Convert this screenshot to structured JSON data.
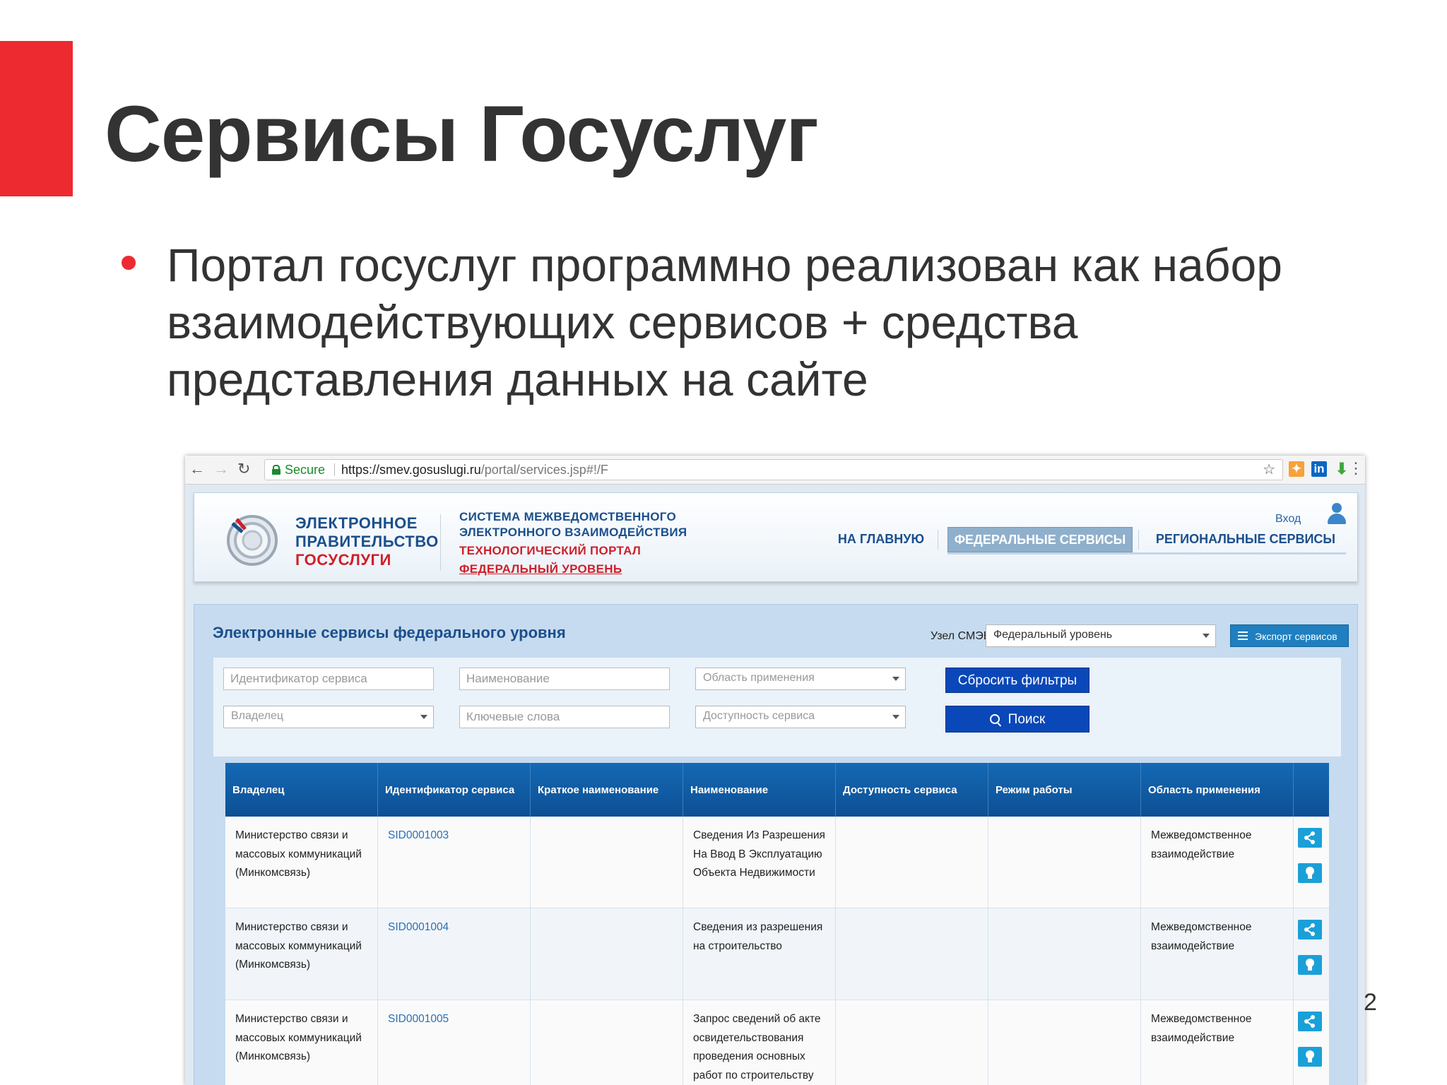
{
  "slide": {
    "title": "Сервисы Госуслуг",
    "bullet": "Портал госуслуг программно реализован как набор взаимодействующих сервисов + средства представления данных на сайте",
    "page_number": "2"
  },
  "browser": {
    "secure_label": "Secure",
    "url_host": "https://smev.gosuslugi.ru",
    "url_path": "/portal/services.jsp#!/F"
  },
  "header": {
    "brand": [
      "ЭЛЕКТРОННОЕ",
      "ПРАВИТЕЛЬСТВО",
      "ГОСУСЛУГИ"
    ],
    "system": [
      "СИСТЕМА МЕЖВЕДОМСТВЕННОГО",
      "ЭЛЕКТРОННОГО ВЗАИМОДЕЙСТВИЯ",
      "ТЕХНОЛОГИЧЕСКИЙ ПОРТАЛ",
      "ФЕДЕРАЛЬНЫЙ УРОВЕНЬ"
    ],
    "login": "Вход",
    "nav": [
      "НА ГЛАВНУЮ",
      "ФЕДЕРАЛЬНЫЕ СЕРВИСЫ",
      "РЕГИОНАЛЬНЫЕ СЕРВИСЫ"
    ]
  },
  "main": {
    "title": "Электронные сервисы федерального уровня",
    "node_label": "Узел СМЭВ:",
    "node_value": "Федеральный уровень",
    "export_label": "Экспорт сервисов"
  },
  "filters": {
    "id_placeholder": "Идентификатор сервиса",
    "name_placeholder": "Наименование",
    "area_placeholder": "Область применения",
    "owner_placeholder": "Владелец",
    "keywords_placeholder": "Ключевые слова",
    "availability_placeholder": "Доступность сервиса",
    "reset_label": "Сбросить фильтры",
    "search_label": "Поиск"
  },
  "table": {
    "columns": [
      "Владелец",
      "Идентификатор сервиса",
      "Краткое наименование",
      "Наименование",
      "Доступность сервиса",
      "Режим работы",
      "Область применения"
    ],
    "rows": [
      {
        "owner": "Министерство связи и массовых коммуникаций (Минкомсвязь)",
        "id": "SID0001003",
        "short": "",
        "name": "Сведения Из Разрешения На Ввод В Эксплуатацию Объекта Недвижимости",
        "availability": "",
        "mode": "",
        "area": "Межведомственное взаимодействие"
      },
      {
        "owner": "Министерство связи и массовых коммуникаций (Минкомсвязь)",
        "id": "SID0001004",
        "short": "",
        "name": "Сведения из разрешения на строительство",
        "availability": "",
        "mode": "",
        "area": "Межведомственное взаимодействие"
      },
      {
        "owner": "Министерство связи и массовых коммуникаций (Минкомсвязь)",
        "id": "SID0001005",
        "short": "",
        "name": "Запрос сведений об акте освидетельствования проведения основных работ по строительству",
        "availability": "",
        "mode": "",
        "area": "Межведомственное взаимодействие"
      }
    ]
  },
  "colors": {
    "accent_red": "#ee2a31",
    "title_gray": "#333333",
    "button_blue": "#0a47b8",
    "table_header_blue": "#1469b4"
  }
}
